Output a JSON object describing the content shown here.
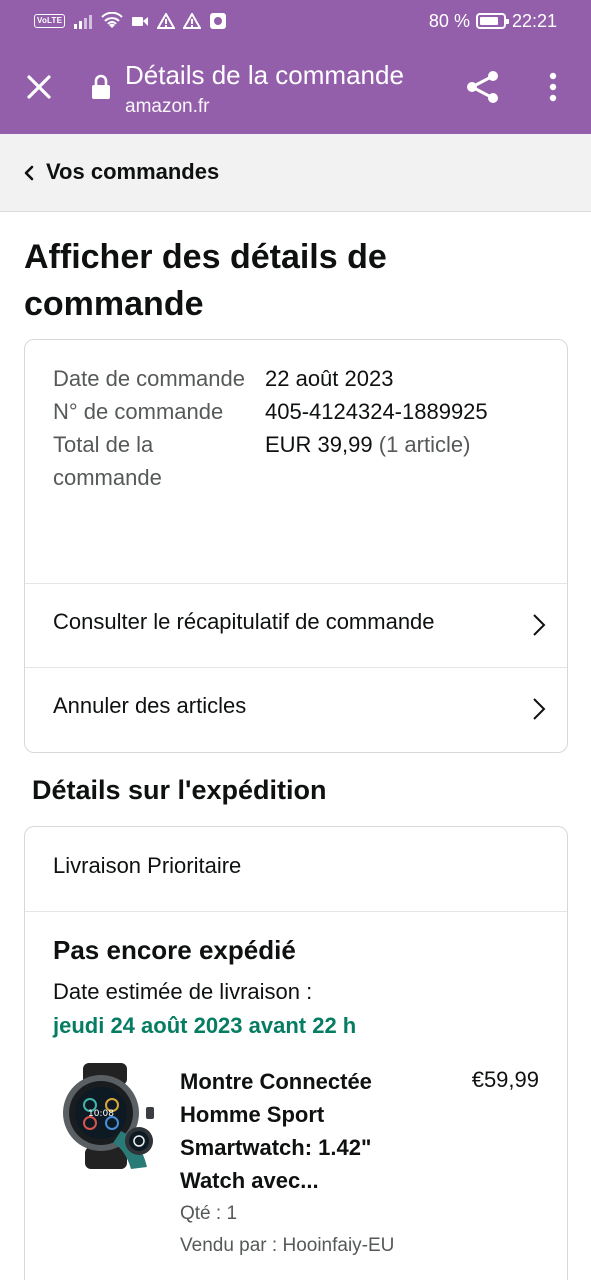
{
  "status_bar": {
    "volte": "VoLTE",
    "battery_text": "80 %",
    "battery_level": 0.8,
    "time": "22:21"
  },
  "browser": {
    "title": "Détails de la commande",
    "domain": "amazon.fr",
    "icons": [
      "close-icon",
      "lock-icon",
      "share-icon",
      "more-vert-icon"
    ]
  },
  "nav": {
    "back_label": "Vos commandes"
  },
  "page": {
    "title": "Afficher des détails de commande"
  },
  "order": {
    "rows": [
      {
        "label": "Date de commande",
        "value": "22 août 2023",
        "extra": ""
      },
      {
        "label": "N° de commande",
        "value": "405-4124324-1889925",
        "extra": ""
      },
      {
        "label": "Total de la commande",
        "value": "EUR 39,99",
        "extra": " (1 article)"
      }
    ],
    "links": [
      {
        "label": "Consulter le récapitulatif de commande"
      },
      {
        "label": "Annuler des articles"
      }
    ]
  },
  "shipment": {
    "section_title": "Détails sur l'expédition",
    "method": "Livraison Prioritaire",
    "status": "Pas encore expédié",
    "estimate_label": "Date estimée de livraison :",
    "estimate_date": "jeudi 24 août 2023 avant 22 h",
    "product": {
      "title": "Montre Connectée Homme Sport Smartwatch: 1.42\" Watch avec...",
      "price": "€59,99",
      "qty": "Qté : 1",
      "seller": "Vendu par : Hooinfaiy-EU",
      "watch_time": "10:08"
    }
  },
  "colors": {
    "browser_bar": "#935faa",
    "delivery_green": "#067d62",
    "text": "#0f1111",
    "muted": "#565959"
  }
}
